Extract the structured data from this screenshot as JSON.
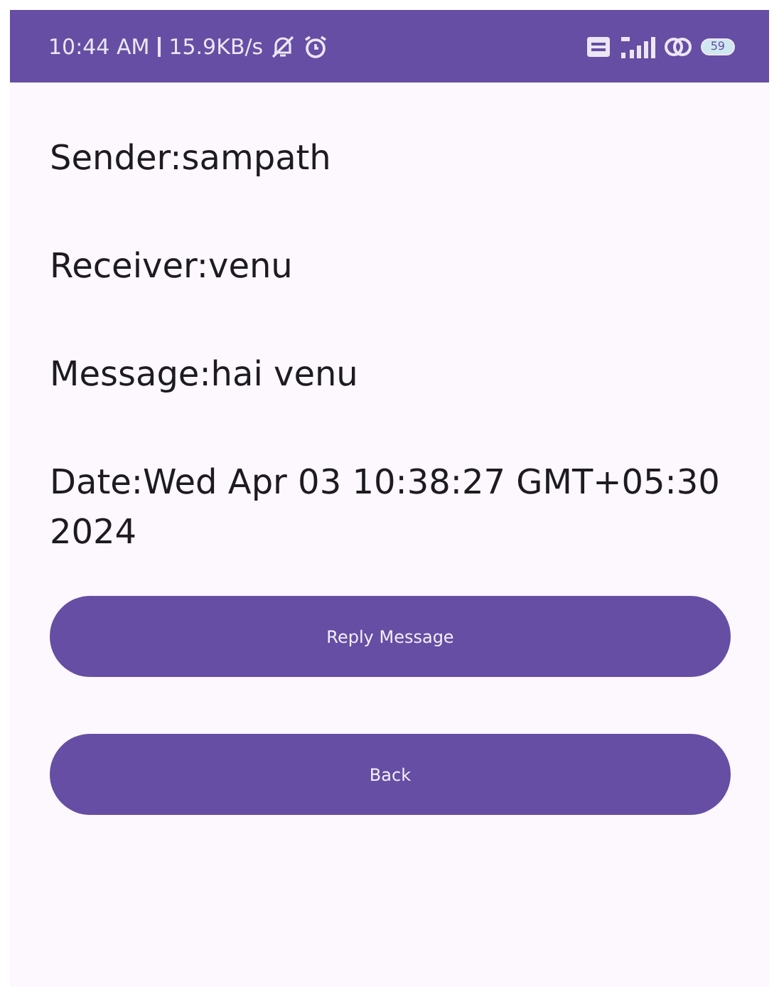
{
  "status_bar": {
    "time": "10:44 AM",
    "speed": "15.9KB/s",
    "battery": "59"
  },
  "fields": [
    {
      "text": "Sender:sampath"
    },
    {
      "text": "Receiver:venu"
    },
    {
      "text": "Message:hai venu"
    },
    {
      "text": "Date:Wed Apr 03 10:38:27 GMT+05:30 2024"
    }
  ],
  "buttons": [
    "Reply Message",
    "Back"
  ]
}
